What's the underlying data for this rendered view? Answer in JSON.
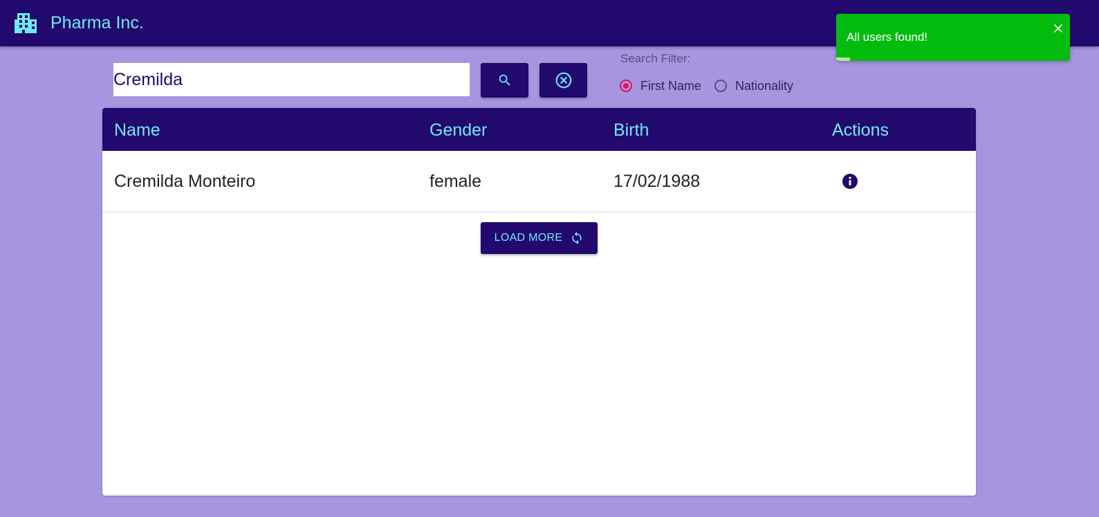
{
  "app": {
    "title": "Pharma Inc.",
    "icon": "building-icon"
  },
  "search": {
    "value": "Cremilda",
    "search_icon": "search-icon",
    "clear_icon": "clear-circle-icon"
  },
  "filter": {
    "label": "Search Filter:",
    "options": [
      {
        "label": "First Name",
        "checked": true
      },
      {
        "label": "Nationality",
        "checked": false
      }
    ]
  },
  "table": {
    "headers": [
      "Name",
      "Gender",
      "Birth",
      "Actions"
    ],
    "rows": [
      {
        "name": "Cremilda Monteiro",
        "gender": "female",
        "birth": "17/02/1988",
        "action_icon": "info-icon"
      }
    ],
    "load_more_label": "LOAD MORE",
    "load_more_icon": "refresh-icon"
  },
  "toast": {
    "message": "All users found!",
    "close_icon": "close-icon",
    "progress_fraction": 0.06
  },
  "colors": {
    "primary": "#22096e",
    "accent_text": "#6fe9f6",
    "background": "#a795e0",
    "radio_checked": "#e0115f",
    "toast_success": "#04bc0e"
  }
}
